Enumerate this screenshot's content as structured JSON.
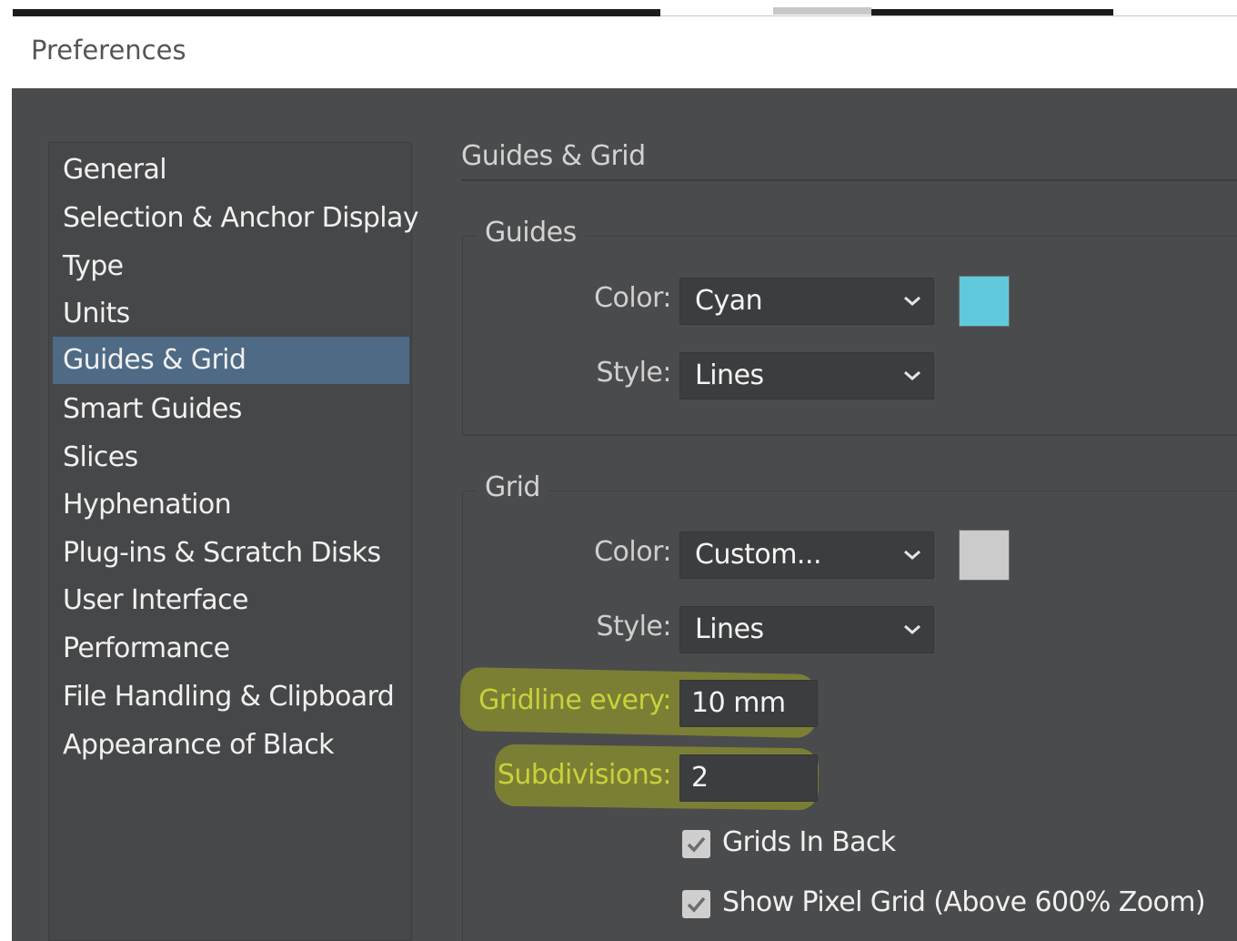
{
  "window": {
    "title": "Preferences"
  },
  "sidebar": {
    "items": [
      {
        "label": "General"
      },
      {
        "label": "Selection & Anchor Display"
      },
      {
        "label": "Type"
      },
      {
        "label": "Units"
      },
      {
        "label": "Guides & Grid",
        "selected": true
      },
      {
        "label": "Smart Guides"
      },
      {
        "label": "Slices"
      },
      {
        "label": "Hyphenation"
      },
      {
        "label": "Plug-ins & Scratch Disks"
      },
      {
        "label": "User Interface"
      },
      {
        "label": "Performance"
      },
      {
        "label": "File Handling & Clipboard"
      },
      {
        "label": "Appearance of Black"
      }
    ]
  },
  "panel": {
    "title": "Guides & Grid"
  },
  "guides": {
    "title": "Guides",
    "color_label": "Color:",
    "color_value": "Cyan",
    "swatch_color": "#60cadc",
    "style_label": "Style:",
    "style_value": "Lines"
  },
  "grid": {
    "title": "Grid",
    "color_label": "Color:",
    "color_value": "Custom...",
    "swatch_color": "#cbcbcb",
    "style_label": "Style:",
    "style_value": "Lines",
    "gridline_label": "Gridline every:",
    "gridline_value": "10 mm",
    "subdivisions_label": "Subdivisions:",
    "subdivisions_value": "2",
    "grids_in_back_label": "Grids In Back",
    "grids_in_back_checked": true,
    "pixel_grid_label": "Show Pixel Grid (Above 600% Zoom)",
    "pixel_grid_checked": true
  },
  "colors": {
    "dialog_bg": "#4a4b4d",
    "selected_item": "#4e6a84",
    "highlight_label": "#c8d23a",
    "highlight_mark": "#bec814"
  }
}
